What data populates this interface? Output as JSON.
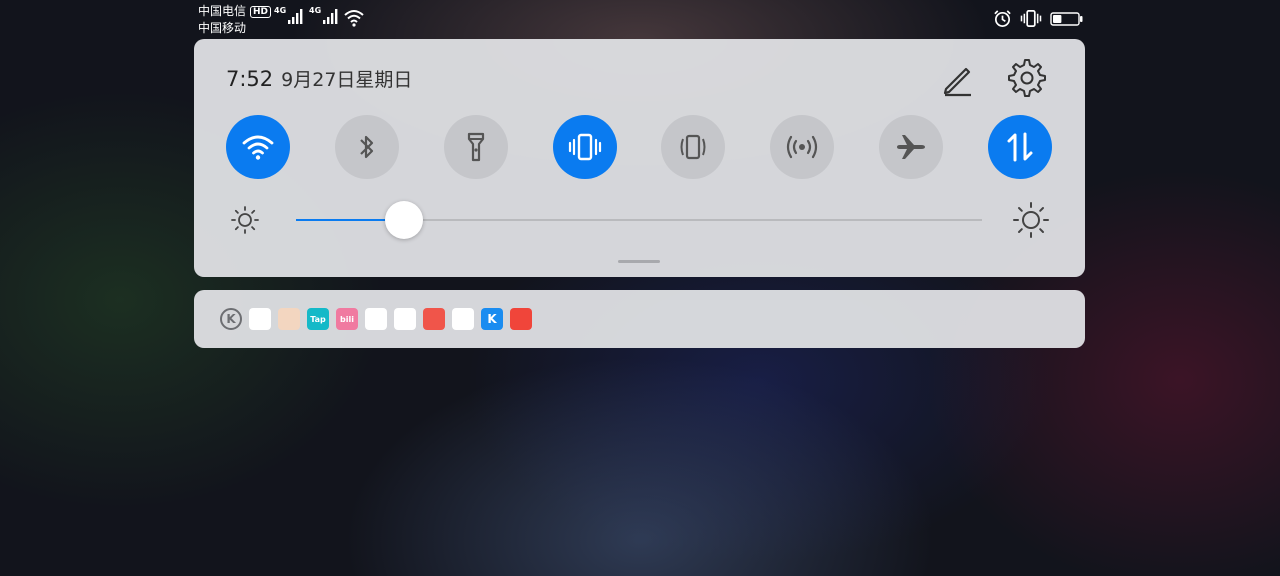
{
  "status_bar": {
    "carrier1": "中国电信",
    "carrier1_badge": "HD",
    "carrier2": "中国移动",
    "signal1_label": "4G",
    "signal2_label": "4G",
    "icons_left": [
      "signal-icon",
      "signal-icon",
      "wifi-icon"
    ],
    "icons_right": [
      "alarm-icon",
      "vibrate-icon",
      "battery-icon"
    ],
    "battery_level": 0.35
  },
  "quick_panel": {
    "time": "7:52",
    "date": "9月27日星期日",
    "actions": [
      "edit-icon",
      "gear-icon"
    ],
    "toggles": [
      {
        "icon": "wifi-icon",
        "on": true
      },
      {
        "icon": "bluetooth-icon",
        "on": false
      },
      {
        "icon": "flashlight-icon",
        "on": false
      },
      {
        "icon": "vibrate-icon",
        "on": true
      },
      {
        "icon": "auto-rotate-icon",
        "on": false
      },
      {
        "icon": "hotspot-icon",
        "on": false
      },
      {
        "icon": "airplane-icon",
        "on": false
      },
      {
        "icon": "mobile-data-icon",
        "on": true
      }
    ],
    "brightness": 0.158
  },
  "notification_bar": {
    "app_icons": [
      {
        "name": "k-app-icon",
        "color": "#6d6e72",
        "label": "K"
      },
      {
        "name": "baidu-icon",
        "color": "#ffffff",
        "label": ""
      },
      {
        "name": "comic-app-icon",
        "color": "#f3d6c0",
        "label": ""
      },
      {
        "name": "tap-icon",
        "color": "#14b9c8",
        "label": "Tap"
      },
      {
        "name": "bilibili-icon",
        "color": "#f07aa0",
        "label": "bili"
      },
      {
        "name": "browser-icon",
        "color": "#ffffff",
        "label": ""
      },
      {
        "name": "globe-app-icon",
        "color": "#ffffff",
        "label": ""
      },
      {
        "name": "reader-icon",
        "color": "#f0554a",
        "label": ""
      },
      {
        "name": "compass-app-icon",
        "color": "#ffffff",
        "label": ""
      },
      {
        "name": "kugou-icon",
        "color": "#1a8cf0",
        "label": "K"
      },
      {
        "name": "huawei-mall-icon",
        "color": "#f0453a",
        "label": ""
      }
    ]
  }
}
